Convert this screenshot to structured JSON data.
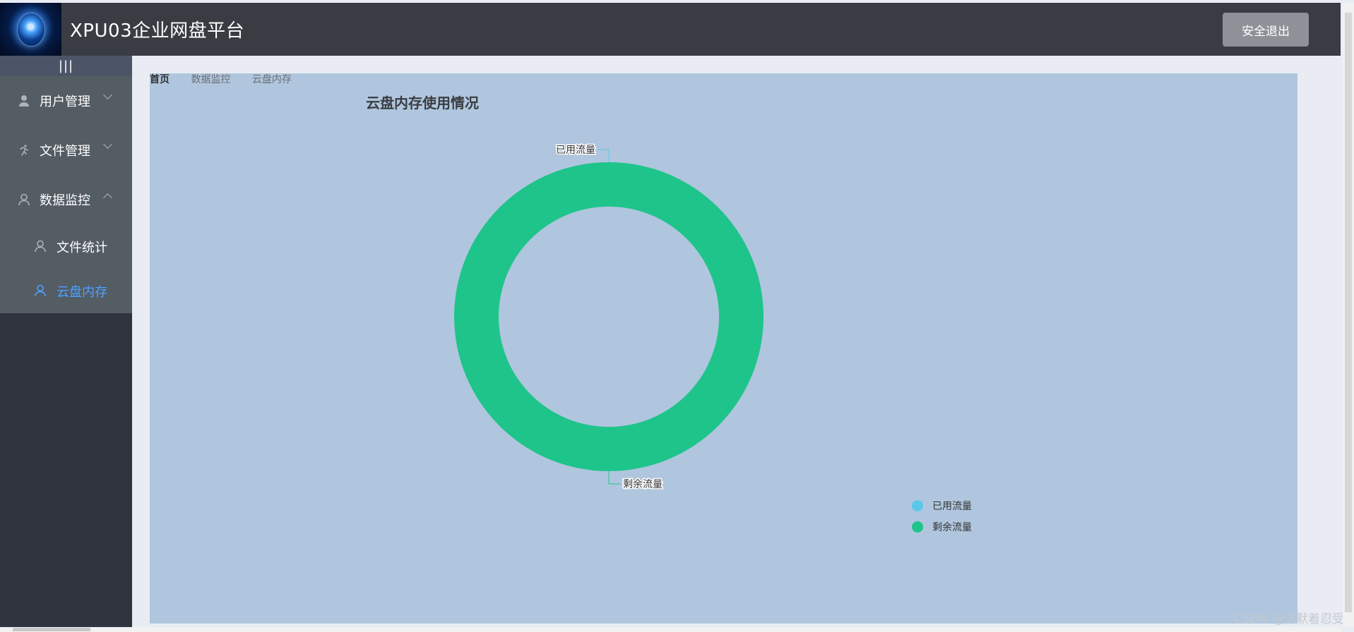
{
  "header": {
    "title": "XPU03企业网盘平台",
    "logout_label": "安全退出"
  },
  "sidebar": {
    "collapse_label": "|||",
    "items": [
      {
        "label": "用户管理",
        "icon": "user-icon",
        "expanded": false
      },
      {
        "label": "文件管理",
        "icon": "running-icon",
        "expanded": false
      },
      {
        "label": "数据监控",
        "icon": "person-outline-icon",
        "expanded": true
      }
    ],
    "sub_items": [
      {
        "label": "文件统计",
        "icon": "person-outline-icon",
        "active": false
      },
      {
        "label": "云盘内存",
        "icon": "person-outline-icon",
        "active": true
      }
    ]
  },
  "breadcrumb": [
    "首页",
    "数据监控",
    "云盘内存"
  ],
  "chart_data": {
    "type": "pie",
    "title": "云盘内存使用情况",
    "slices": [
      {
        "name": "已用流量",
        "value": 0,
        "color": "#5ac8e8"
      },
      {
        "name": "剩余流量",
        "value": 100,
        "color": "#1fc48b"
      }
    ],
    "legend": [
      "已用流量",
      "剩余流量"
    ],
    "legend_position": "bottom-right"
  },
  "watermark": "CSDN @沉默着忍受",
  "colors": {
    "header_bg": "#393d43",
    "sidebar_bg": "#30343e",
    "menu_bg": "#545c64",
    "active_color": "#4da3ff",
    "panel_bg": "#b0c6de"
  }
}
